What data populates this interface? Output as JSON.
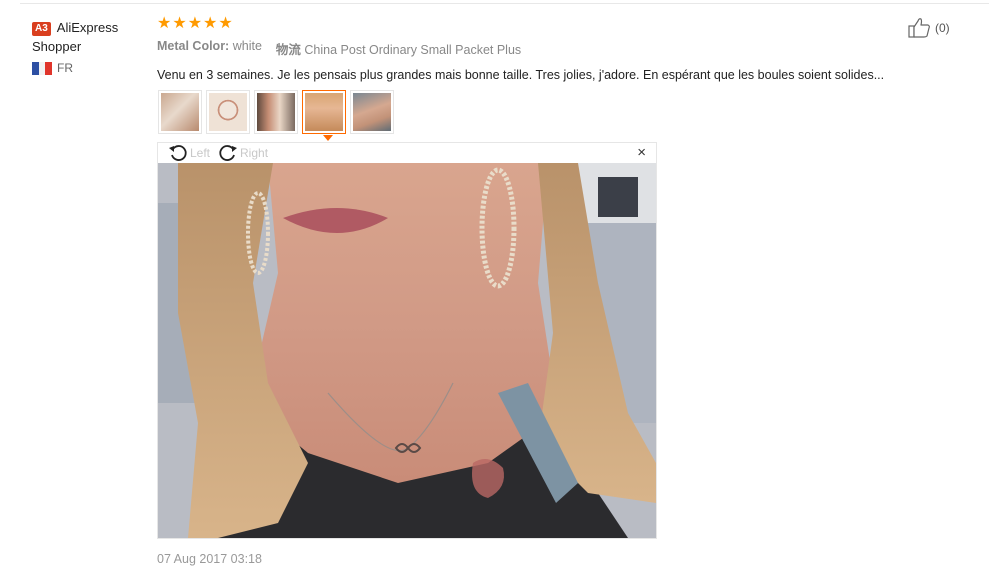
{
  "reviewer": {
    "level_badge": "A3",
    "name_line1": "AliExpress",
    "name_line2": "Shopper",
    "country_code": "FR",
    "flag_colors": [
      "#2d4fa3",
      "#f2f2f2",
      "#e0352b"
    ]
  },
  "review": {
    "rating": 5,
    "star_color": "#ff9a00",
    "attr1_label": "Metal Color:",
    "attr1_value": "white",
    "attr2_label": "物流",
    "attr2_value": "China Post Ordinary Small Packet Plus",
    "text": "Venu en 3 semaines. Je les pensais plus grandes mais bonne taille. Tres jolies, j'adore. En espérant que les boules soient solides...",
    "date": "07 Aug 2017 03:18"
  },
  "helpful": {
    "count": "(0)",
    "icon": "thumbs-up-icon"
  },
  "viewer": {
    "rotate_left": "Left",
    "rotate_right": "Right",
    "close_symbol": "×",
    "selected_index": 3,
    "accent_color": "#ff6a00"
  }
}
